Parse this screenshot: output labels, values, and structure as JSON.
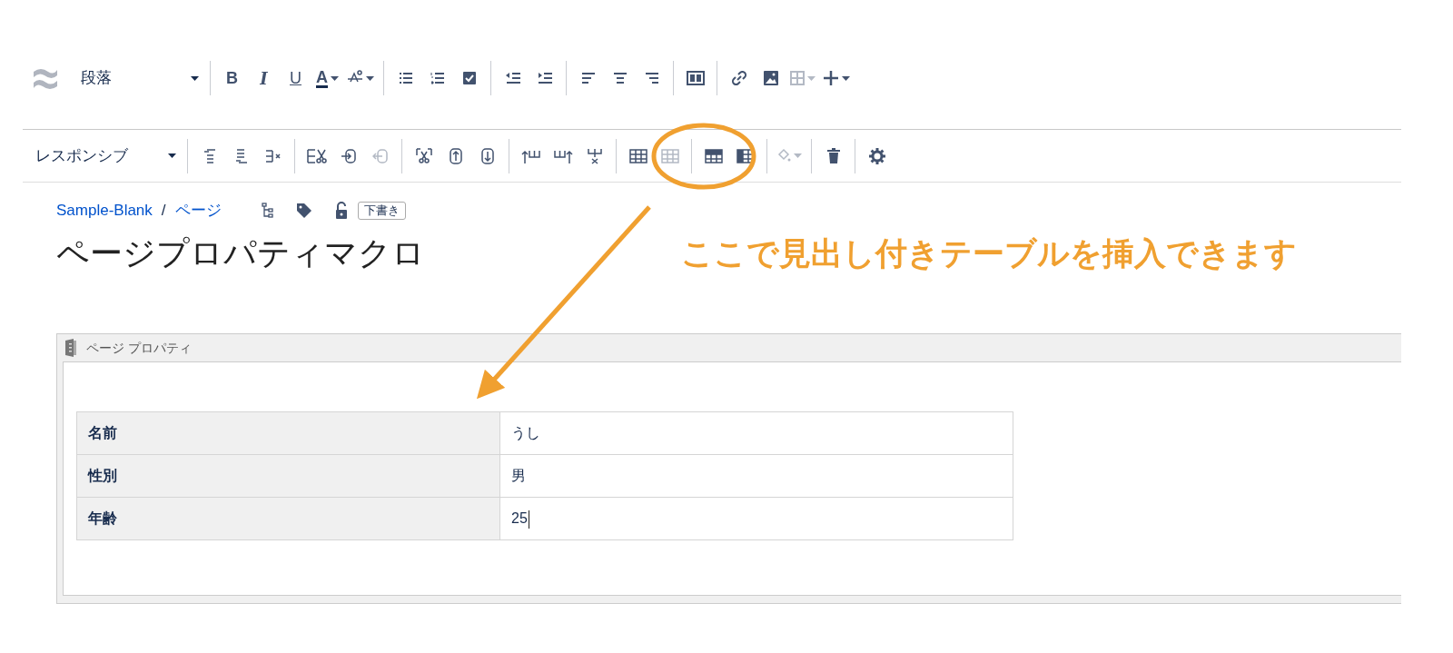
{
  "toolbar_1": {
    "style_select": {
      "value": "段落"
    },
    "groups": [
      [
        {
          "kind": "text",
          "label": "B",
          "dropdown": false,
          "disabled": false
        },
        {
          "kind": "text",
          "label": "I",
          "dropdown": false,
          "disabled": false
        },
        {
          "kind": "text",
          "label": "U",
          "dropdown": false,
          "disabled": false
        },
        {
          "kind": "text",
          "label": "A",
          "dropdown": true,
          "disabled": false
        },
        {
          "kind": "icon",
          "dropdown": true,
          "disabled": false
        }
      ],
      [
        {
          "kind": "icon",
          "dropdown": false,
          "disabled": false
        },
        {
          "kind": "icon",
          "dropdown": false,
          "disabled": false
        },
        {
          "kind": "icon",
          "dropdown": false,
          "disabled": false
        }
      ],
      [
        {
          "kind": "icon",
          "dropdown": false,
          "disabled": false
        },
        {
          "kind": "icon",
          "dropdown": false,
          "disabled": false
        }
      ],
      [
        {
          "kind": "icon",
          "dropdown": false,
          "disabled": false
        },
        {
          "kind": "icon",
          "dropdown": false,
          "disabled": false
        },
        {
          "kind": "icon",
          "dropdown": false,
          "disabled": false
        }
      ],
      [
        {
          "kind": "icon",
          "dropdown": false,
          "disabled": false
        }
      ],
      [
        {
          "kind": "icon",
          "dropdown": false,
          "disabled": false
        },
        {
          "kind": "icon",
          "dropdown": false,
          "disabled": false
        },
        {
          "kind": "icon",
          "dropdown": true,
          "disabled": true
        },
        {
          "kind": "icon",
          "dropdown": true,
          "disabled": false
        }
      ]
    ]
  },
  "toolbar_2": {
    "style_select": {
      "value": "レスポンシブ"
    },
    "groups": [
      [
        {
          "kind": "icon",
          "dropdown": false,
          "disabled": false
        },
        {
          "kind": "icon",
          "dropdown": false,
          "disabled": false
        },
        {
          "kind": "icon",
          "dropdown": false,
          "disabled": false
        }
      ],
      [
        {
          "kind": "icon",
          "dropdown": false,
          "disabled": false
        },
        {
          "kind": "icon",
          "dropdown": false,
          "disabled": false
        },
        {
          "kind": "icon",
          "dropdown": false,
          "disabled": true
        }
      ],
      [
        {
          "kind": "icon",
          "dropdown": false,
          "disabled": false
        },
        {
          "kind": "icon",
          "dropdown": false,
          "disabled": false
        },
        {
          "kind": "icon",
          "dropdown": false,
          "disabled": false
        }
      ],
      [
        {
          "kind": "icon",
          "dropdown": false,
          "disabled": false
        },
        {
          "kind": "icon",
          "dropdown": false,
          "disabled": false
        },
        {
          "kind": "icon",
          "dropdown": false,
          "disabled": false
        }
      ],
      [
        {
          "kind": "icon",
          "dropdown": false,
          "disabled": false
        },
        {
          "kind": "icon",
          "dropdown": false,
          "disabled": true
        }
      ],
      [
        {
          "kind": "icon",
          "dropdown": false,
          "disabled": false
        },
        {
          "kind": "icon",
          "dropdown": false,
          "disabled": false
        }
      ],
      [
        {
          "kind": "icon",
          "dropdown": true,
          "disabled": true
        }
      ],
      [
        {
          "kind": "icon",
          "dropdown": false,
          "disabled": false
        }
      ],
      [
        {
          "kind": "icon",
          "dropdown": false,
          "disabled": false
        }
      ]
    ]
  },
  "breadcrumb": [
    {
      "label": "Sample-Blank"
    },
    {
      "label": "ページ"
    }
  ],
  "breadcrumb_separator": "/",
  "status_badge": "下書き",
  "page_title": "ページプロパティマクロ",
  "annotation": {
    "text": "ここで見出し付きテーブルを挿入できます"
  },
  "macro": {
    "title": "ページ プロパティ",
    "table": {
      "rows": [
        {
          "header": "名前",
          "value": "うし",
          "text_cursor": false
        },
        {
          "header": "性別",
          "value": "男",
          "text_cursor": false
        },
        {
          "header": "年齢",
          "value": "25",
          "text_cursor": true
        }
      ]
    }
  }
}
